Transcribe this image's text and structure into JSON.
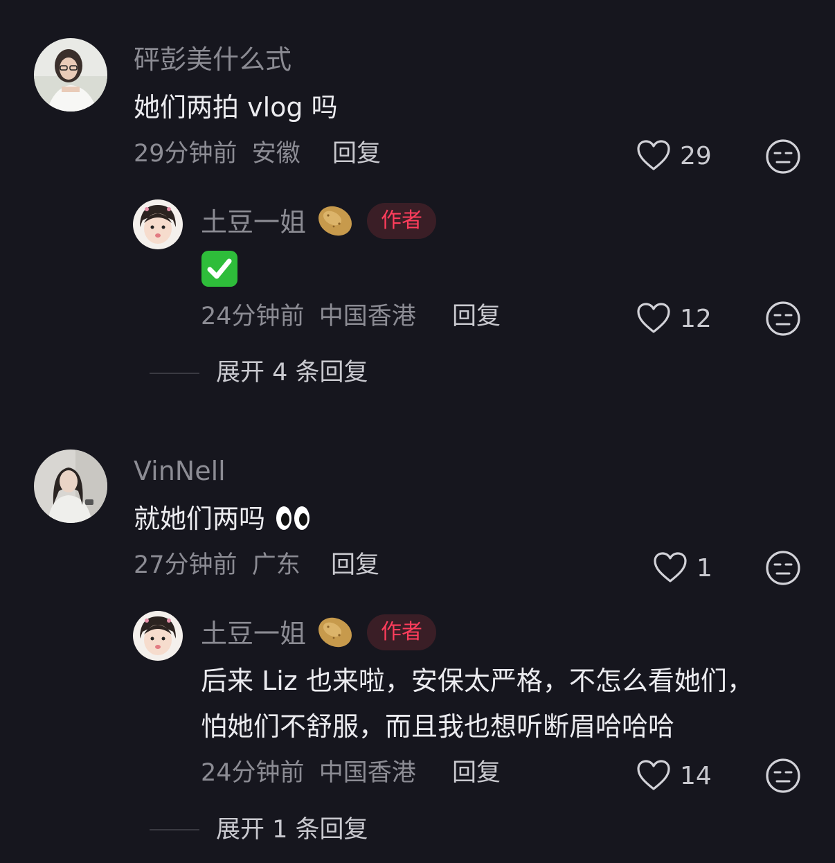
{
  "comments": [
    {
      "username": "砰彭美什么式",
      "text": "她们两拍 vlog 吗",
      "time": "29分钟前",
      "location": "安徽",
      "reply_label": "回复",
      "likes": "29",
      "replies": [
        {
          "username": "土豆一姐",
          "badge": "作者",
          "text": "",
          "emoji": "white-check-mark",
          "time": "24分钟前",
          "location": "中国香港",
          "reply_label": "回复",
          "likes": "12"
        }
      ],
      "expand_label": "展开 4 条回复"
    },
    {
      "username": "VinNell",
      "text": "就她们两吗",
      "time": "27分钟前",
      "location": "广东",
      "reply_label": "回复",
      "likes": "1",
      "replies": [
        {
          "username": "土豆一姐",
          "badge": "作者",
          "text_line1": "后来 Liz 也来啦，安保太严格，不怎么看她们，",
          "text_line2": "怕她们不舒服，而且我也想听断眉哈哈哈",
          "time": "24分钟前",
          "location": "中国香港",
          "reply_label": "回复",
          "likes": "14"
        }
      ],
      "expand_label": "展开 1 条回复"
    }
  ],
  "icons": {
    "like": "heart-outline-icon",
    "dislike": "unamused-face-icon",
    "name_emoji": "potato-emoji",
    "text_emoji": "eyes-emoji"
  },
  "colors": {
    "background": "#16161e",
    "author_badge_text": "#ff3d5c",
    "author_badge_bg": "#3a1e26",
    "check_green": "#2ebd3a"
  }
}
